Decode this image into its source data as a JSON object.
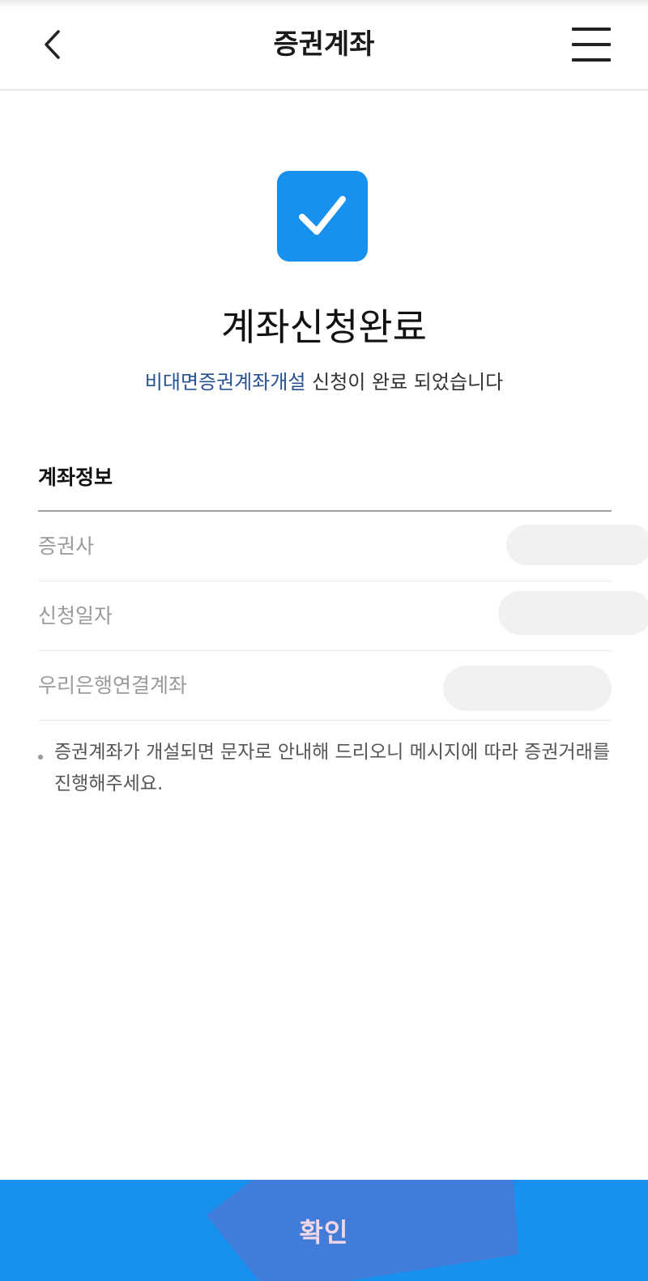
{
  "header": {
    "title": "증권계좌"
  },
  "result": {
    "title": "계좌신청완료",
    "subtitle_highlight": "비대면증권계좌개설",
    "subtitle_rest": " 신청이 완료 되었습니다"
  },
  "account_info": {
    "section_title": "계좌정보",
    "rows": [
      {
        "label": "증권사"
      },
      {
        "label": "신청일자"
      },
      {
        "label": "우리은행연결계좌"
      }
    ]
  },
  "notice": "증권계좌가 개설되면 문자로 안내해 드리오니 메시지에 따라 증권거래를 진행해주세요.",
  "confirm_label": "확인",
  "colors": {
    "accent": "#1790ee",
    "link_text": "#27518f"
  },
  "icons": {
    "back": "chevron-left-icon",
    "menu": "hamburger-menu-icon",
    "success": "checkmark-icon"
  }
}
